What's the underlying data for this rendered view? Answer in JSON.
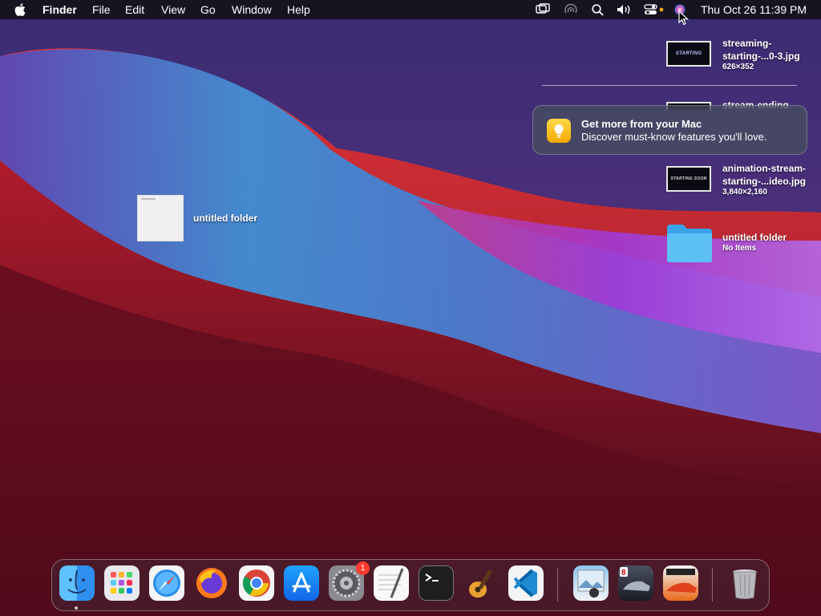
{
  "menubar": {
    "app_name": "Finder",
    "menus": [
      "File",
      "Edit",
      "View",
      "Go",
      "Window",
      "Help"
    ],
    "status_icons": [
      "screen-mirroring-icon",
      "airdrop-icon",
      "spotlight-search-icon",
      "volume-icon",
      "control-center-icon",
      "siri-icon"
    ],
    "clock": "Thu Oct 26  11:39 PM"
  },
  "desktop": {
    "folder_label": "untitled folder"
  },
  "stack": {
    "items": [
      {
        "name": "streaming-\nstarting-...0-3.jpg",
        "line1": "streaming-",
        "line2": "starting-...0-3.jpg",
        "meta": "626×352",
        "thumb_text": "STARTING"
      },
      {
        "line1": "stream-ending",
        "line2": "",
        "meta": ""
      },
      {
        "line1": "animation-stream-",
        "line2": "starting-...ideo.jpg",
        "meta": "3,840×2,160",
        "thumb_text": "STARTING SOON"
      },
      {
        "line1": "untitled folder",
        "line2": "",
        "meta": "No Items"
      }
    ]
  },
  "notification": {
    "title": "Get more from your Mac",
    "body": "Discover must-know features you'll love."
  },
  "dock": {
    "apps": [
      "Finder",
      "Launchpad",
      "Safari",
      "Firefox",
      "Chrome",
      "App Store",
      "System Preferences",
      "TextEdit",
      "Terminal",
      "GarageBand",
      "Visual Studio Code",
      "Preview",
      "Asphalt 8",
      "Asphalt 9",
      "Trash"
    ],
    "settings_badge": "1"
  },
  "colors": {
    "accent_red": "#d6262e",
    "accent_blue": "#3d8fd6",
    "badge_red": "#ff3b30"
  }
}
